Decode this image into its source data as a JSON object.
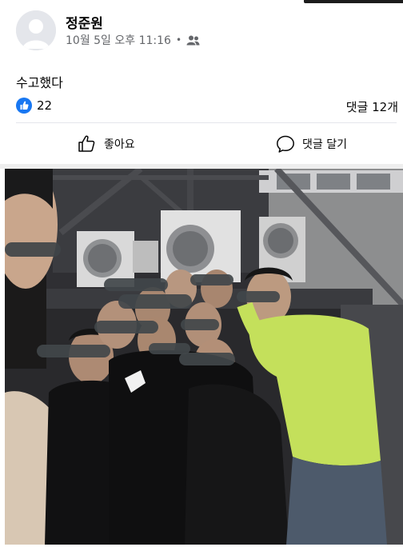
{
  "post": {
    "author": "정준원",
    "timestamp": "10월 5일 오후 11:16",
    "meta_separator": "•",
    "audience_icon": "friends-icon",
    "text": "수고했다"
  },
  "reactions": {
    "like_count": "22",
    "comment_count": "댓글 12개",
    "like_badge_icon": "thumbs-up-icon",
    "like_badge_color": "#1877f2"
  },
  "actions": {
    "like_label": "좋아요",
    "comment_label": "댓글 달기"
  },
  "photo": {
    "description_icon": "group-photo"
  },
  "colors": {
    "text_primary": "#050505",
    "text_secondary": "#65676b",
    "divider": "#e4e6eb"
  }
}
